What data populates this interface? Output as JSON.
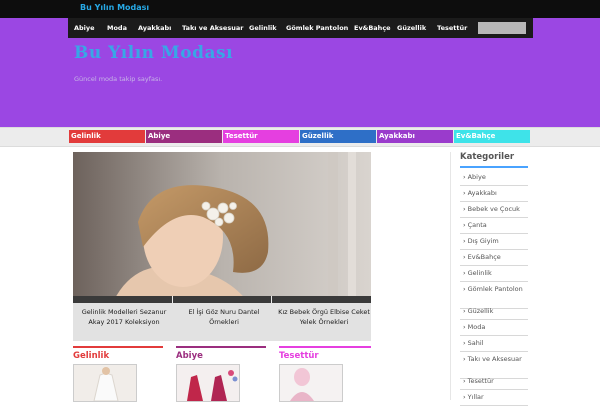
{
  "topbar": {
    "site_link": "Bu Yılın Modası"
  },
  "nav": {
    "items": [
      "Abiye",
      "Moda",
      "Ayakkabı",
      "Takı ve Aksesuar",
      "Gelinlik",
      "Gömlek Pantolon",
      "Ev&Bahçe",
      "Güzellik",
      "Tesettür"
    ],
    "search_placeholder": ""
  },
  "header": {
    "logo": "Bu Yılın Modası",
    "tagline": "Güncel moda takip sayfası.",
    "background_color": "#9b47e3",
    "logo_color": "#38a7e6"
  },
  "category_strip": [
    {
      "label": "Gelinlik",
      "color": "#e23b3b"
    },
    {
      "label": "Abiye",
      "color": "#9b2e7f"
    },
    {
      "label": "Tesettür",
      "color": "#e53fe0"
    },
    {
      "label": "Güzellik",
      "color": "#2e6fc7"
    },
    {
      "label": "Ayakkabı",
      "color": "#9a3bcc"
    },
    {
      "label": "Ev&Bahçe",
      "color": "#3ee3e9"
    }
  ],
  "slider": {
    "captions": [
      "Gelinlik Modelleri Sezanur Akay 2017 Koleksiyon",
      "El İşi Göz Nuru Dantel Örnekleri",
      "Kız Bebek Örgü Elbise Ceket Yelek Örnekleri"
    ]
  },
  "sections": [
    {
      "title": "Gelinlik",
      "color": "#e23b3b"
    },
    {
      "title": "Abiye",
      "color": "#9b2e7f"
    },
    {
      "title": "Tesettür",
      "color": "#e53fe0"
    }
  ],
  "sidebar": {
    "heading": "Kategoriler",
    "items": [
      "Abiye",
      "Ayakkabı",
      "Bebek ve Çocuk",
      "Çanta",
      "Dış Giyim",
      "Ev&Bahçe",
      "Gelinlik",
      "Gömlek Pantolon",
      "Güzellik",
      "Moda",
      "Sahil",
      "Takı ve Aksesuar",
      "Tesettür",
      "Yıllar"
    ]
  }
}
